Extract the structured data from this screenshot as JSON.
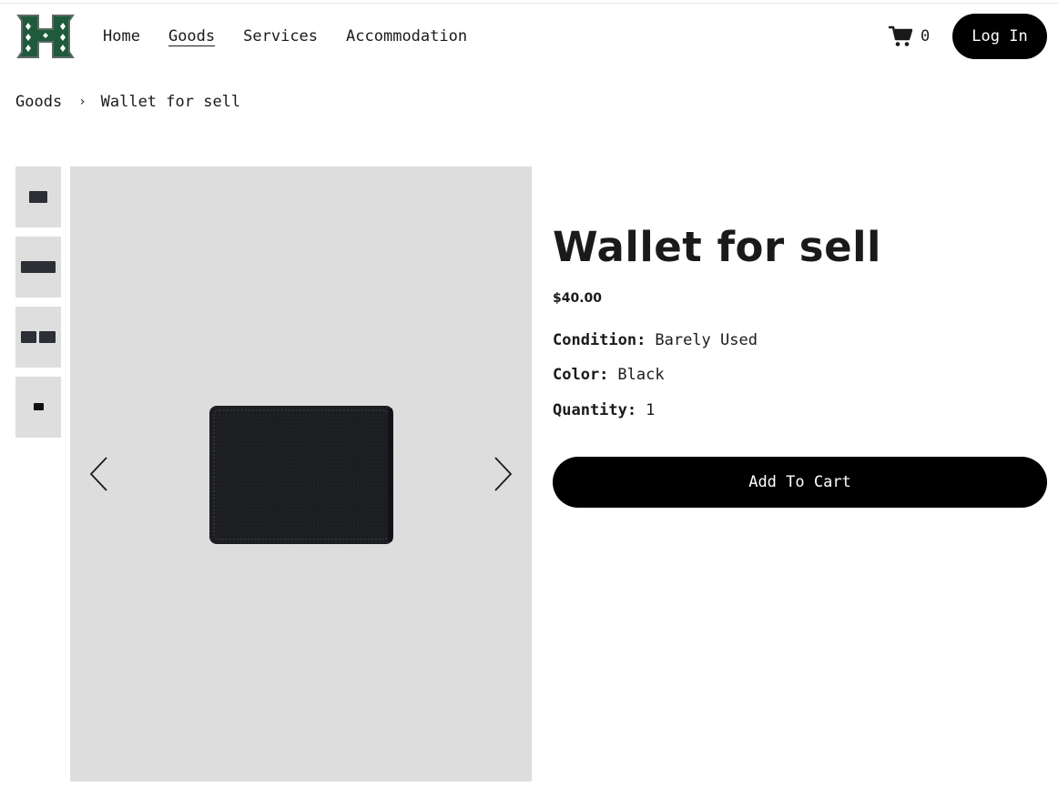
{
  "header": {
    "logo_icon": "H-logo-icon",
    "nav": [
      {
        "label": "Home",
        "active": false
      },
      {
        "label": "Goods",
        "active": true
      },
      {
        "label": "Services",
        "active": false
      },
      {
        "label": "Accommodation",
        "active": false
      }
    ],
    "cart_count": "0",
    "cart_icon": "cart-icon",
    "login_label": "Log In"
  },
  "breadcrumb": {
    "parent": "Goods",
    "separator": "›",
    "current": "Wallet for sell"
  },
  "product": {
    "title": "Wallet for sell",
    "price": "$40.00",
    "attributes": [
      {
        "label": "Condition:",
        "value": "Barely Used"
      },
      {
        "label": "Color:",
        "value": "Black"
      },
      {
        "label": "Quantity:",
        "value": "1"
      }
    ],
    "add_to_cart_label": "Add To Cart",
    "thumbnail_count": 4,
    "colors": {
      "accent_green": "#1e5a3c",
      "button": "#000000",
      "image_bg": "#dddddd"
    }
  }
}
